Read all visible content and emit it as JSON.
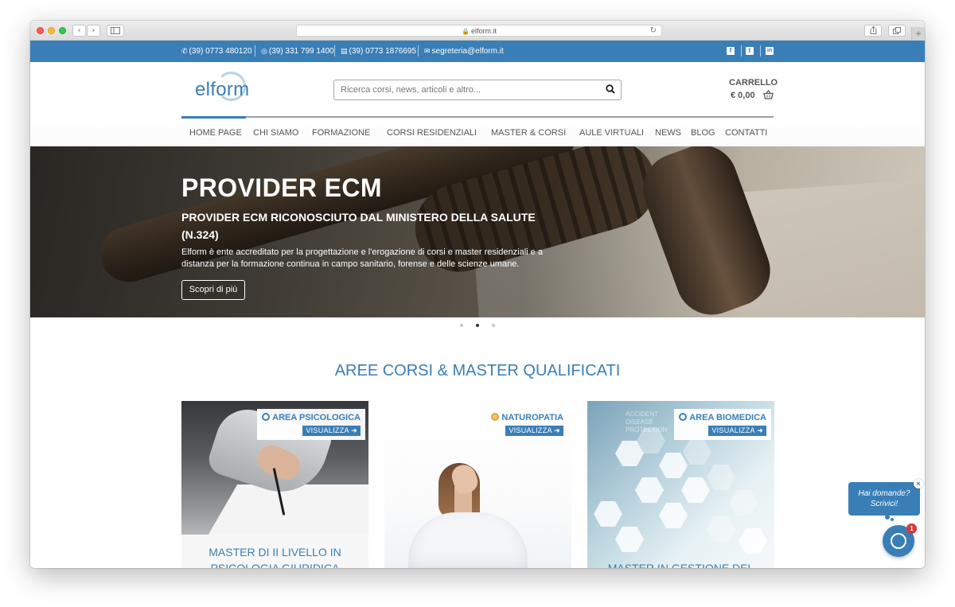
{
  "browser": {
    "url": "elform.it"
  },
  "topbar": {
    "contacts": [
      {
        "icon": "phone-icon",
        "text": "(39) 0773 480120"
      },
      {
        "icon": "whatsapp-icon",
        "text": "(39) 331 799 1400"
      },
      {
        "icon": "fax-icon",
        "text": "(39) 0773 1876695"
      },
      {
        "icon": "email-icon",
        "text": "segreteria@elform.it"
      }
    ],
    "social": [
      {
        "icon": "facebook-icon",
        "glyph": "f"
      },
      {
        "icon": "twitter-icon",
        "glyph": "t"
      },
      {
        "icon": "linkedin-icon",
        "glyph": "in"
      }
    ],
    "color": "#3a7eb7"
  },
  "header": {
    "logo": "elform",
    "search_placeholder": "Ricerca corsi, news, articoli e altro...",
    "cart_label": "CARRELLO",
    "cart_total": "€ 0,00"
  },
  "nav": {
    "items": [
      "HOME PAGE",
      "CHI SIAMO",
      "FORMAZIONE",
      "CORSI RESIDENZIALI",
      "MASTER & CORSI",
      "AULE VIRTUALI",
      "NEWS",
      "BLOG",
      "CONTATTI"
    ],
    "active": "HOME PAGE"
  },
  "hero": {
    "title": "PROVIDER ECM",
    "subtitle": "PROVIDER ECM RICONOSCIUTO DAL MINISTERO DELLA SALUTE (N.324)",
    "description": "Elform è ente accreditato per la progettazione e l'erogazione di corsi e master residenziali e a distanza per la formazione continua in campo sanitario, forense e delle scienze umane.",
    "button": "Scopri di più",
    "slides": 3,
    "active_slide": 2
  },
  "section": {
    "title": "AREE CORSI & MASTER QUALIFICATI"
  },
  "cards": [
    {
      "badge": "AREA PSICOLOGICA",
      "link": "VISUALIZZA",
      "title": "MASTER DI II LIVELLO IN PSICOLOGIA GIURIDICA"
    },
    {
      "badge": "NATUROPATIA",
      "link": "VISUALIZZA",
      "title": ""
    },
    {
      "badge": "AREA BIOMEDICA",
      "link": "VISUALIZZA",
      "title": "MASTER IN GESTIONE DEL"
    }
  ],
  "chat": {
    "line1": "Hai domande?",
    "line2": "Scrivici!",
    "close": "×",
    "count": "1"
  }
}
